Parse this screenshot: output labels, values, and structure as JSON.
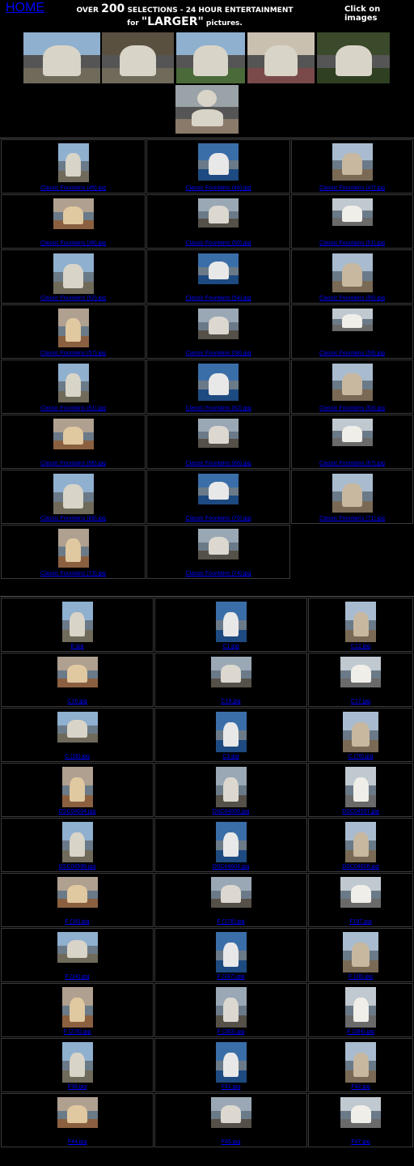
{
  "header": {
    "home": "HOME",
    "line1_a": "OVER ",
    "line1_num": "200",
    "line1_b": " SELECTIONS  - 24 HOUR ENTERTAINMENT",
    "line2_a": "for ",
    "line2_big": "\"LARGER\"",
    "line2_b": "  pictures.",
    "click": "Click on images"
  },
  "gallery1": [
    "Classic Fountains (45).jpg",
    "Classic Fountains (46).jpg",
    "Classic Fountains (47).jpg",
    "Classic Fountains (48).jpg",
    "Classic Fountains (50).jpg",
    "Classic Fountains (51).jpg",
    "Classic Fountains (52).jpg",
    "Classic Fountains (54).jpg",
    "Classic Fountains (56).jpg",
    "Classic Fountains (57).jpg",
    "Classic Fountains (58).jpg",
    "Classic Fountains (59).jpg",
    "Classic Fountains (61).jpg",
    "Classic Fountains (62).jpg",
    "Classic Fountains (63).jpg",
    "Classic Fountains (66).jpg",
    "Classic Fountains (66).jpg",
    "Classic Fountains (67).jpg",
    "Classic Fountains (68).jpg",
    "Classic Fountains (70).jpg",
    "Classic Fountains (71).jpg",
    "Classic Fountains (73).jpg",
    "Classic Fountains (74).jpg"
  ],
  "gallery2": [
    "E.jpg",
    "C1.jpg",
    "C12.jpg",
    "C16.jpg",
    "C19.jpg",
    "C17.jpg",
    "C (26).jpg",
    "C3.jpg",
    "C (76).jpg",
    "DSC04004.jpg",
    "DSC04005.jpg",
    "DSC04597.jpg",
    "DSC04598.jpg",
    "DSC04604.jpg",
    "DSC04606.jpg",
    "F (16).jpg",
    "F (178).jpg",
    "F197.jpg",
    "F (24).jpg",
    "F (247).jpg",
    "F (26).jpg",
    "F (276).jpg",
    "F (283).jpg",
    "F (284).jpg",
    "F39.jpg",
    "F41.jpg",
    "F42.jpg",
    "F44.jpg",
    "F45.jpg",
    "F47.jpg"
  ]
}
